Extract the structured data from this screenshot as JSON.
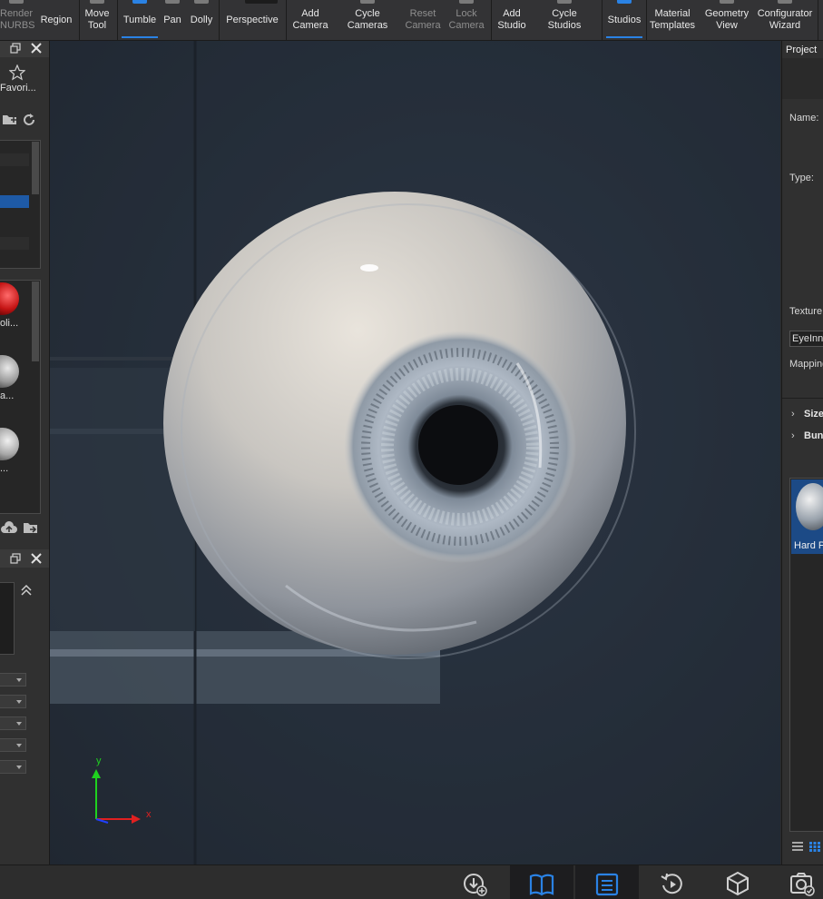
{
  "toolbar": {
    "render_nurbs": "Render\nNURBS",
    "region": "Region",
    "move_tool": "Move\nTool",
    "tumble": "Tumble",
    "pan": "Pan",
    "dolly": "Dolly",
    "perspective": "Perspective",
    "add_camera": "Add\nCamera",
    "cycle_cameras": "Cycle\nCameras",
    "reset_camera": "Reset\nCamera",
    "lock_camera": "Lock\nCamera",
    "add_studio": "Add\nStudio",
    "cycle_studios": "Cycle\nStudios",
    "studios": "Studios",
    "material_templates": "Material\nTemplates",
    "geometry_view": "Geometry\nView",
    "configurator_wizard": "Configurator\nWizard"
  },
  "left_panel": {
    "favorites_label": "Favori...",
    "thumb_labels": [
      "oli...",
      "a...",
      "..."
    ]
  },
  "right_panel": {
    "tab": "Project",
    "name_label": "Name:",
    "type_label": "Type:",
    "texture_label": "Texture",
    "texture_value": "EyeInn",
    "mapping_label": "Mapping",
    "size_section": "Size",
    "bump_section": "Bun",
    "material_label": "Hard P"
  },
  "viewport": {
    "axis_y": "y",
    "axis_x": "x"
  },
  "colors": {
    "accent": "#2a82e4",
    "panel": "#303030",
    "toolbar": "#333335"
  }
}
